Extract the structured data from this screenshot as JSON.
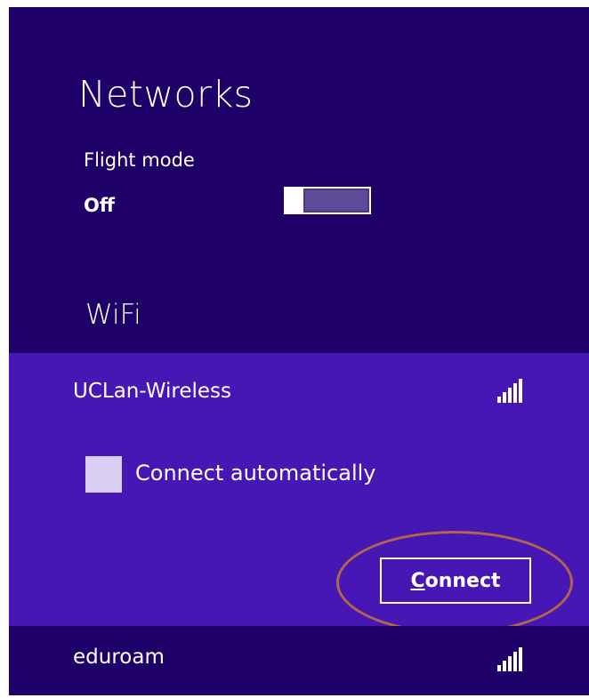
{
  "panel": {
    "title": "Networks",
    "background": "#1f0068",
    "selected_background": "#4617b4",
    "highlight_color": "#b1654c"
  },
  "flight_mode": {
    "label": "Flight mode",
    "state": "Off",
    "toggle_on": false
  },
  "wifi": {
    "section_label": "WiFi",
    "networks": [
      {
        "name": "UCLan-Wireless",
        "signal_icon": "signal-strength-icon",
        "selected": true,
        "connect_automatically": {
          "label": "Connect automatically",
          "checked": false
        },
        "connect_button": {
          "mnemonic": "C",
          "rest": "onnect"
        }
      },
      {
        "name": "eduroam",
        "signal_icon": "signal-strength-icon",
        "selected": false
      }
    ]
  }
}
